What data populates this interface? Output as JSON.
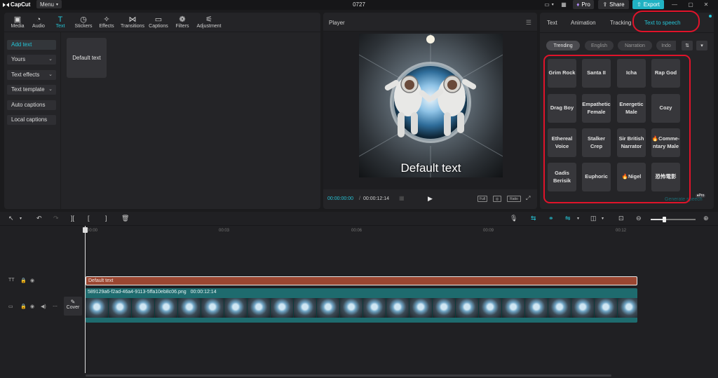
{
  "app": {
    "logo_text": "CapCut",
    "menu_label": "Menu",
    "project_title": "0727",
    "pro_label": "Pro",
    "share_label": "Share",
    "export_label": "Export"
  },
  "media_tabs": [
    {
      "label": "Media",
      "icon": "media-icon"
    },
    {
      "label": "Audio",
      "icon": "audio-icon"
    },
    {
      "label": "Text",
      "icon": "text-icon"
    },
    {
      "label": "Stickers",
      "icon": "stickers-icon"
    },
    {
      "label": "Effects",
      "icon": "effects-icon"
    },
    {
      "label": "Transitions",
      "icon": "transitions-icon"
    },
    {
      "label": "Captions",
      "icon": "captions-icon"
    },
    {
      "label": "Filters",
      "icon": "filters-icon"
    },
    {
      "label": "Adjustment",
      "icon": "adjustment-icon"
    }
  ],
  "active_media_tab": "Text",
  "text_nav": [
    {
      "label": "Add text",
      "has_chevron": false
    },
    {
      "label": "Yours",
      "has_chevron": true
    },
    {
      "label": "Text effects",
      "has_chevron": true
    },
    {
      "label": "Text template",
      "has_chevron": true
    },
    {
      "label": "Auto captions",
      "has_chevron": false
    },
    {
      "label": "Local captions",
      "has_chevron": false
    }
  ],
  "text_card_label": "Default text",
  "player": {
    "title": "Player",
    "overlay_text": "Default text",
    "timecode_current": "00:00:00:00",
    "timecode_total": "00:00:12:14",
    "full_label": "Full",
    "ratio_label": "Ratio"
  },
  "right_panel": {
    "tabs": [
      "Text",
      "Animation",
      "Tracking",
      "Text to speech"
    ],
    "active_tab": "Text to speech",
    "filters": [
      "Trending",
      "English",
      "Narration",
      "Indo"
    ],
    "active_filter": "Trending",
    "voices": [
      "Grim Rock",
      "Santa II",
      "Icha",
      "Rap God",
      "Drag Boy",
      "Empathetic Female",
      "Energetic Male",
      "Cozy",
      "Ethereal Voice",
      "Stalker Crep",
      "Sir British Narrator",
      "🔥Comme-ntary Male",
      "Gadis Berisik",
      "Euphoric",
      "🔥Nigel",
      "恐怖電影"
    ],
    "generate_label": "Generate speech",
    "pro_badge": "Pro"
  },
  "timeline": {
    "ruler_labels": [
      "00:00",
      "00:03",
      "00:06",
      "00:09",
      "00:12"
    ],
    "text_clip_label": "Default text",
    "video_clip_label": "589129a6-f2ad-46a4-9113-5ffa10eb8c06.png",
    "video_clip_duration": "00:00:12:14",
    "cover_label": "Cover"
  },
  "colors": {
    "accent": "#25c4d6",
    "export_bg": "#20b2c3",
    "text_clip": "#9a4631",
    "video_clip": "#1e6b6e",
    "highlight_ring": "#e0132a"
  }
}
